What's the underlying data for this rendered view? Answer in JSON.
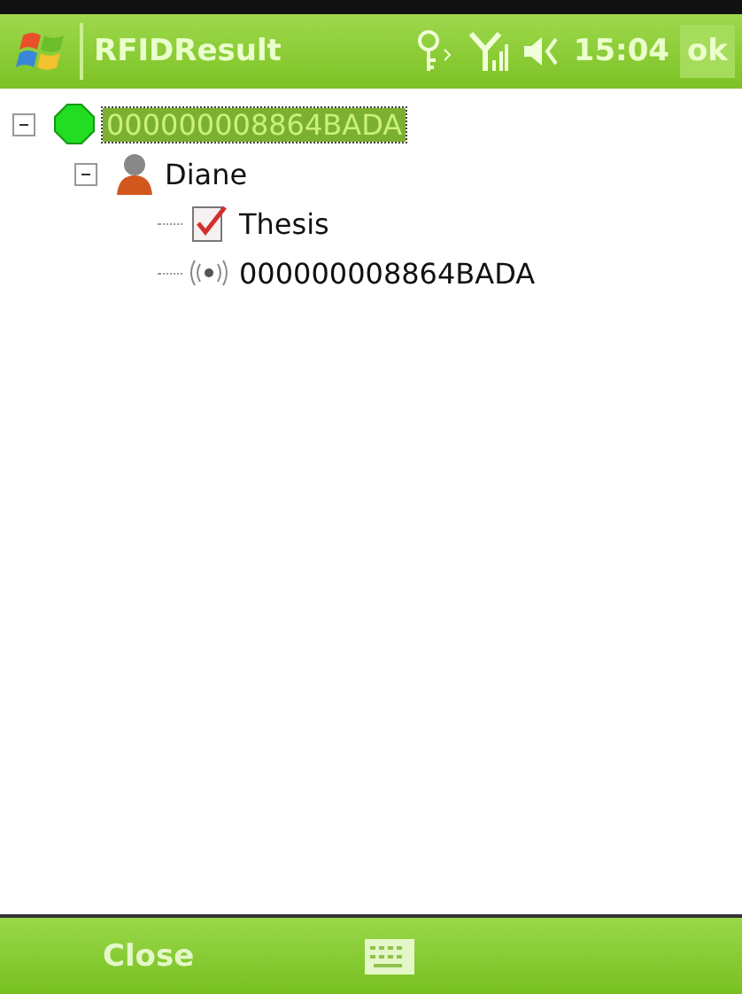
{
  "title_bar": {
    "title": "RFIDResult",
    "time": "15:04",
    "ok_label": "ok"
  },
  "tree": [
    {
      "kind": "status",
      "label": "000000008864BADA",
      "selected": true,
      "expanded": true,
      "children": [
        {
          "kind": "person",
          "label": "Diane",
          "selected": false,
          "expanded": true,
          "children": [
            {
              "kind": "task",
              "label": "Thesis",
              "selected": false
            },
            {
              "kind": "tag",
              "label": "000000008864BADA",
              "selected": false
            }
          ]
        }
      ]
    }
  ],
  "softkeys": {
    "left": "Close"
  }
}
